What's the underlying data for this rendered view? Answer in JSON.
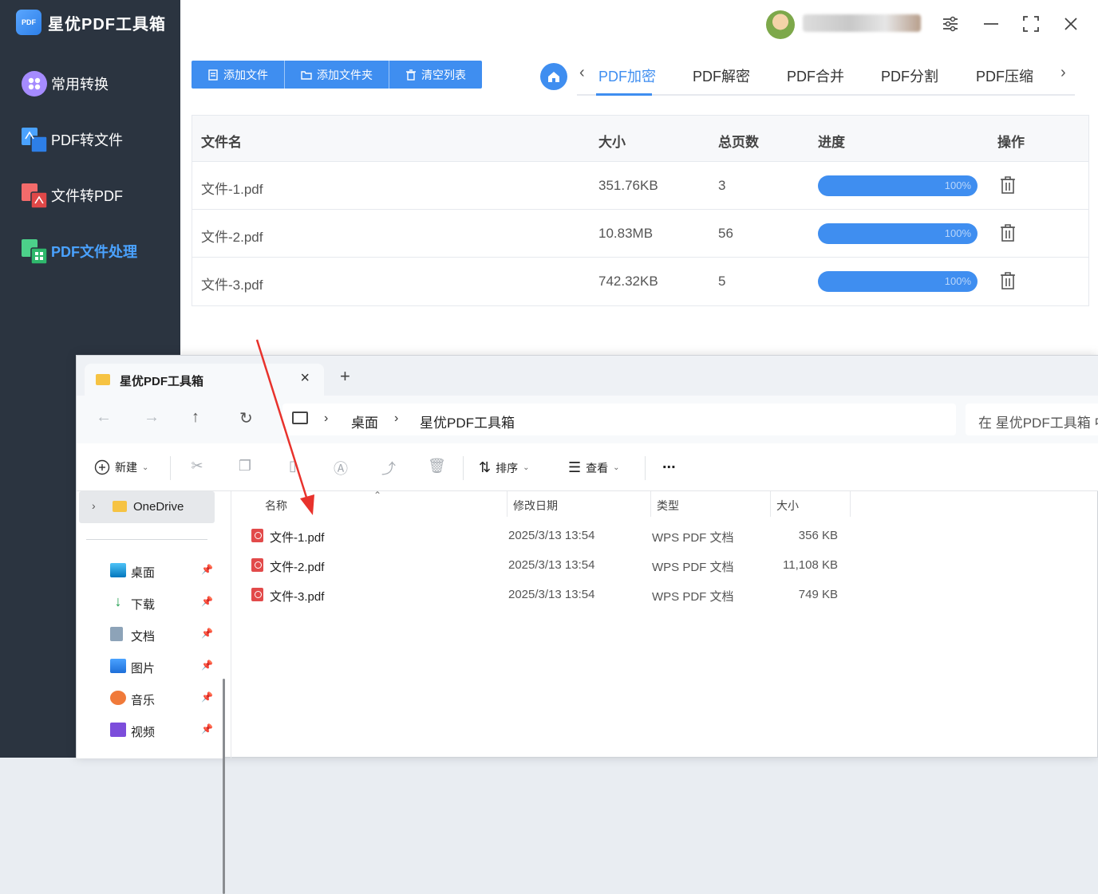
{
  "app": {
    "title": "星优PDF工具箱",
    "logo_text": "PDF",
    "sidebar": [
      {
        "label": "常用转换",
        "icon": "grid-icon"
      },
      {
        "label": "PDF转文件",
        "icon": "pdf-to-file-icon"
      },
      {
        "label": "文件转PDF",
        "icon": "file-to-pdf-icon"
      },
      {
        "label": "PDF文件处理",
        "icon": "pdf-process-icon",
        "active": true
      }
    ],
    "toolbar": {
      "add_file": "添加文件",
      "add_folder": "添加文件夹",
      "clear_list": "清空列表"
    },
    "tabs": [
      "PDF加密",
      "PDF解密",
      "PDF合并",
      "PDF分割",
      "PDF压缩"
    ],
    "active_tab": "PDF加密",
    "table": {
      "headers": [
        "文件名",
        "大小",
        "总页数",
        "进度",
        "操作"
      ],
      "rows": [
        {
          "name": "文件-1.pdf",
          "size": "351.76KB",
          "pages": "3",
          "progress": "100%"
        },
        {
          "name": "文件-2.pdf",
          "size": "10.83MB",
          "pages": "56",
          "progress": "100%"
        },
        {
          "name": "文件-3.pdf",
          "size": "742.32KB",
          "pages": "5",
          "progress": "100%"
        }
      ]
    },
    "accent_color": "#3f8ef0",
    "sidebar_color": "#2b3440"
  },
  "explorer": {
    "tab_title": "星优PDF工具箱",
    "breadcrumb": [
      "桌面",
      "星优PDF工具箱"
    ],
    "search_placeholder": "在 星优PDF工具箱 中",
    "commands": {
      "new": "新建",
      "sort": "排序",
      "view": "查看",
      "more": "..."
    },
    "nav_tree": {
      "onedrive": "OneDrive",
      "quick_access": [
        "桌面",
        "下载",
        "文档",
        "图片",
        "音乐",
        "视频"
      ]
    },
    "columns": [
      "名称",
      "修改日期",
      "类型",
      "大小"
    ],
    "files": [
      {
        "name": "文件-1.pdf",
        "date": "2025/3/13 13:54",
        "type": "WPS PDF 文档",
        "size": "356 KB"
      },
      {
        "name": "文件-2.pdf",
        "date": "2025/3/13 13:54",
        "type": "WPS PDF 文档",
        "size": "11,108 KB"
      },
      {
        "name": "文件-3.pdf",
        "date": "2025/3/13 13:54",
        "type": "WPS PDF 文档",
        "size": "749 KB"
      }
    ]
  },
  "annotation_arrow_color": "#e8322c"
}
